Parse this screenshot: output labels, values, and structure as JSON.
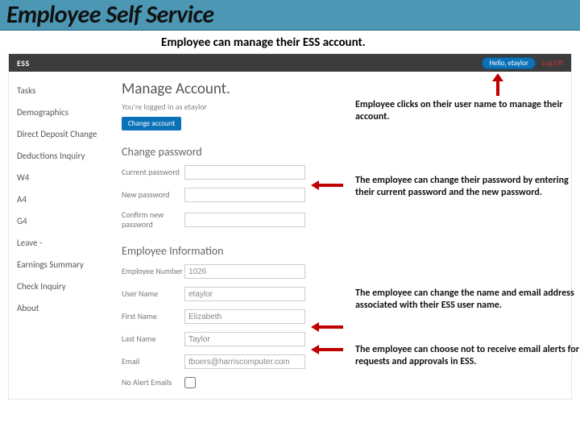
{
  "slide": {
    "title": "Employee Self Service",
    "subtitle": "Employee can manage their ESS account."
  },
  "topbar": {
    "brand": "ESS",
    "hello": "Hello, etaylor",
    "logoff": "Log Off"
  },
  "sidebar": {
    "items": [
      "Tasks",
      "Demographics",
      "Direct Deposit Change",
      "Deductions Inquiry",
      "W4",
      "A4",
      "G4",
      "Leave -",
      "Earnings Summary",
      "Check Inquiry",
      "About"
    ]
  },
  "content": {
    "heading": "Manage Account.",
    "logged_in": "You're logged in as etaylor",
    "change_btn": "Change account",
    "change_pw_heading": "Change password",
    "pw_current_label": "Current password",
    "pw_new_label": "New password",
    "pw_confirm_label": "Confirm new password",
    "emp_info_heading": "Employee Information",
    "emp_number_label": "Employee Number",
    "emp_number_value": "1026",
    "username_label": "User Name",
    "username_value": "etaylor",
    "firstname_label": "First Name",
    "firstname_value": "Elizabeth",
    "lastname_label": "Last Name",
    "lastname_value": "Taylor",
    "email_label": "Email",
    "email_value": "tboers@harriscomputer.com",
    "noalert_label": "No Alert Emails"
  },
  "callouts": {
    "c1": "Employee clicks on their user name to manage their account.",
    "c2": "The employee can change their password by entering their current password and the new password.",
    "c3": "The employee can change the name and email address associated with their ESS user name.",
    "c4": "The employee can choose not to receive email alerts for requests and approvals in ESS."
  }
}
